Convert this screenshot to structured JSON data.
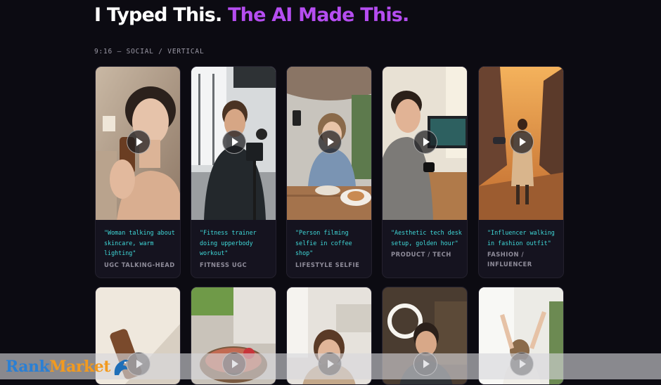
{
  "header": {
    "title_white": "I Typed This.",
    "title_purple": "The AI Made This.",
    "section_label": "9:16 — SOCIAL / VERTICAL"
  },
  "colors": {
    "background": "#0c0b12",
    "accent_purple": "#b54df0",
    "caption_cyan": "#3fd8d8",
    "tag_gray": "#8f8c9a"
  },
  "cards": [
    {
      "caption": "\"Woman talking about skincare, warm lighting\"",
      "tag": "UGC TALKING-HEAD"
    },
    {
      "caption": "\"Fitness trainer doing upperbody workout\"",
      "tag": "FITNESS UGC"
    },
    {
      "caption": "\"Person filming selfie in coffee shop\"",
      "tag": "LIFESTYLE SELFIE"
    },
    {
      "caption": "\"Aesthetic tech desk setup, golden hour\"",
      "tag": "PRODUCT / TECH"
    },
    {
      "caption": "\"Influencer walking in fashion outfit\"",
      "tag": "FASHION / INFLUENCER"
    }
  ],
  "watermark": {
    "brand_part1": "Rank",
    "brand_part2": "Market"
  }
}
